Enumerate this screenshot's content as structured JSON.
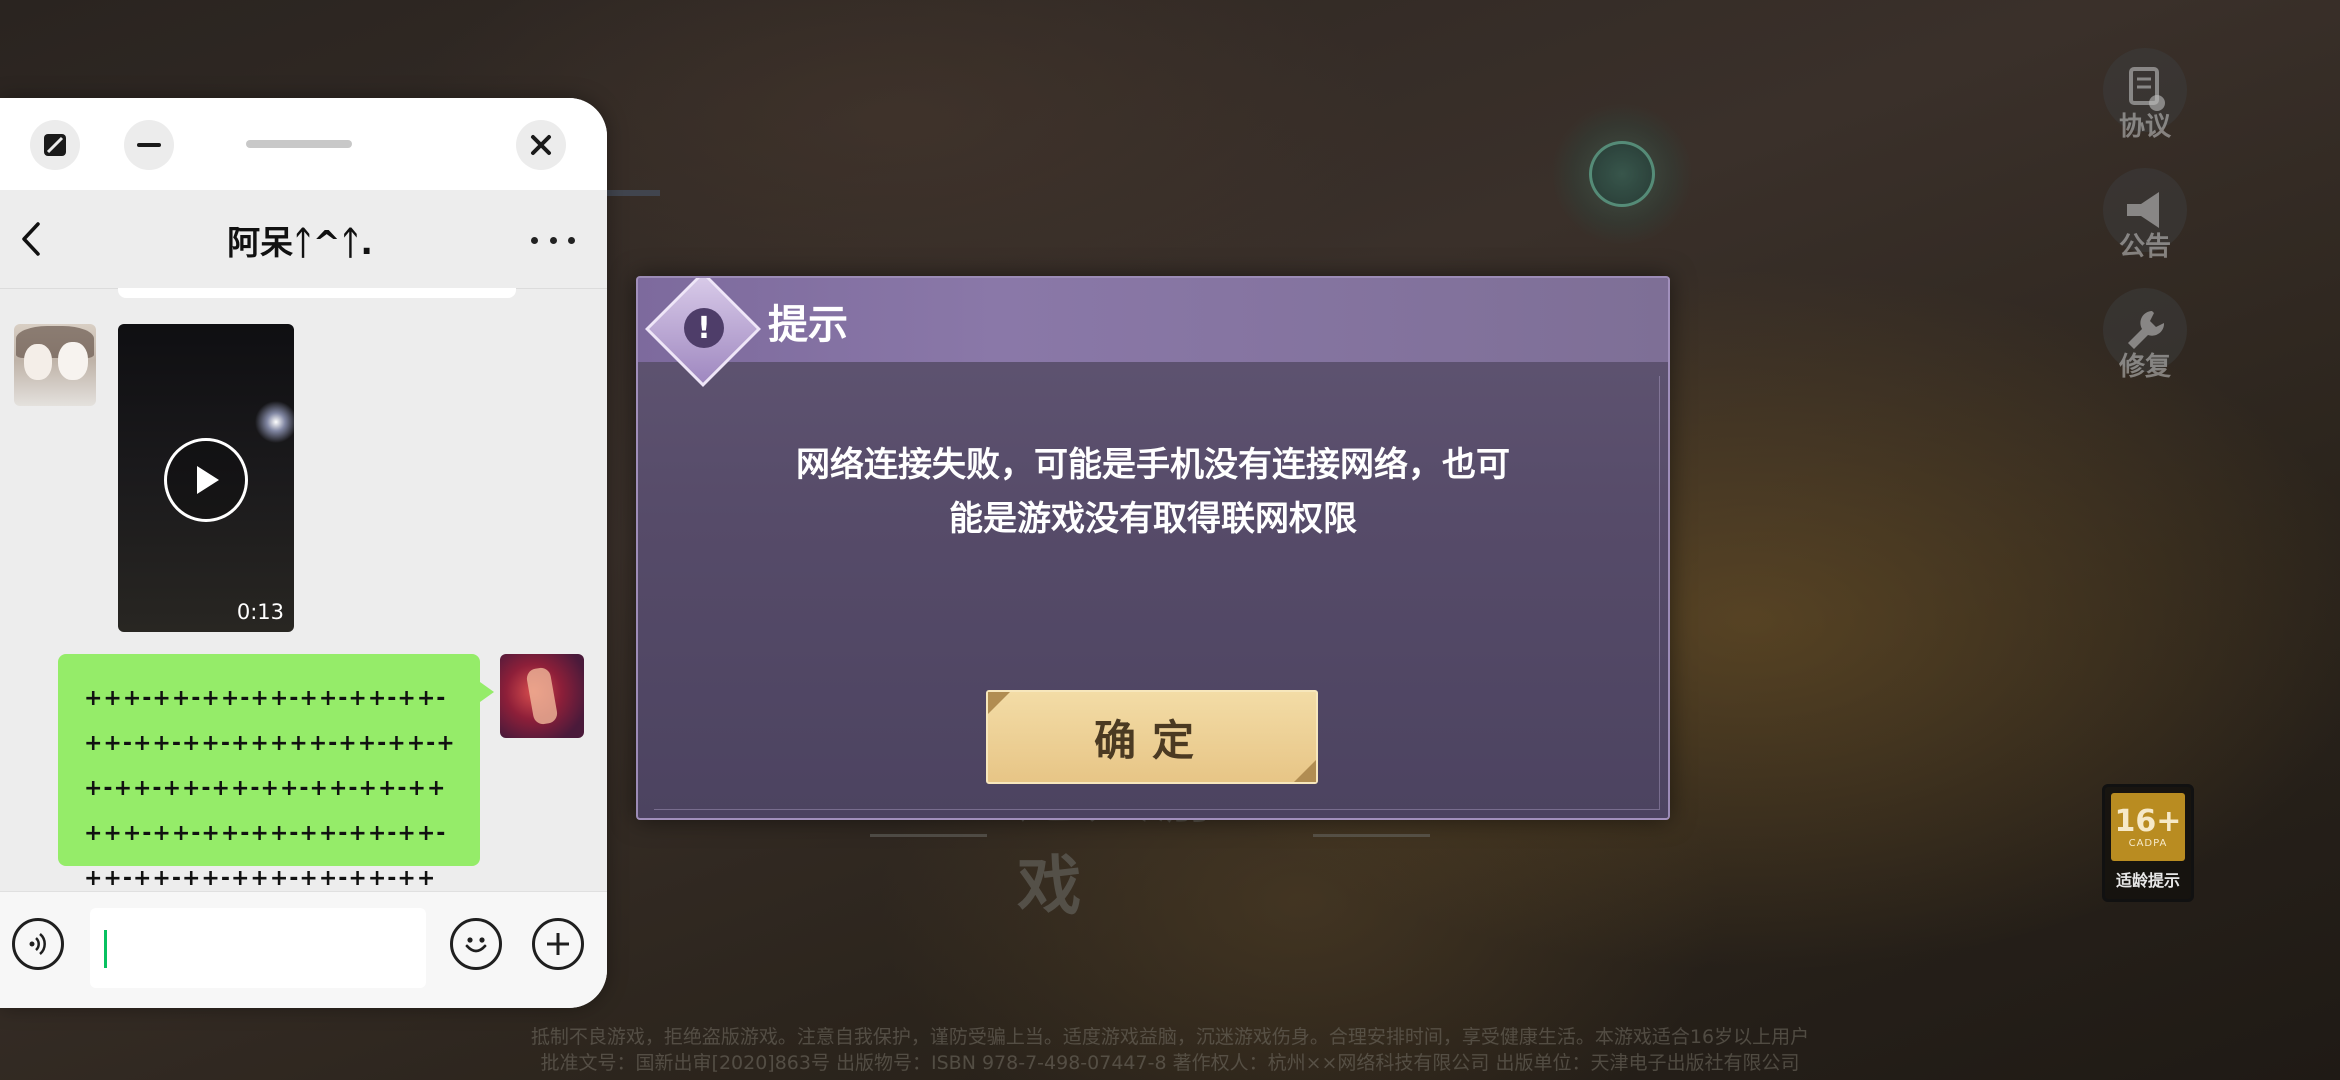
{
  "game": {
    "side_buttons": [
      {
        "label": "协议",
        "icon": "document-check-icon"
      },
      {
        "label": "公告",
        "icon": "megaphone-icon"
      },
      {
        "label": "修复",
        "icon": "wrench-icon"
      }
    ],
    "enter_game_label": "进入游戏",
    "age_rating": {
      "number": "16+",
      "sub": "CADPA",
      "tip": "适龄提示"
    },
    "footer_lines": [
      "抵制不良游戏，拒绝盗版游戏。注意自我保护，谨防受骗上当。适度游戏益脑，沉迷游戏伤身。合理安排时间，享受健康生活。本游戏适合16岁以上用户",
      "批准文号：国新出审[2020]863号  出版物号：ISBN 978-7-498-07447-8  著作权人：杭州××网络科技有限公司  出版单位：天津电子出版社有限公司"
    ]
  },
  "dialog": {
    "title": "提示",
    "message_line1": "网络连接失败，可能是手机没有连接网络，也可",
    "message_line2": "能是游戏没有取得联网权限",
    "confirm_label": "确定",
    "accent_color": "#f0d69e"
  },
  "chat": {
    "contact_name": "阿呆ᛏ^ᛏ.",
    "video_duration": "0:13",
    "message_text": "+++-++-++-++-++-++-++-++-++-++-+++++-++-++-++-++-++-++-++-++-++-+++++-++-++-++-++-++-++-++-++-++-+++-++-++-++",
    "input_value": "",
    "bubble_color": "#95ec69"
  }
}
